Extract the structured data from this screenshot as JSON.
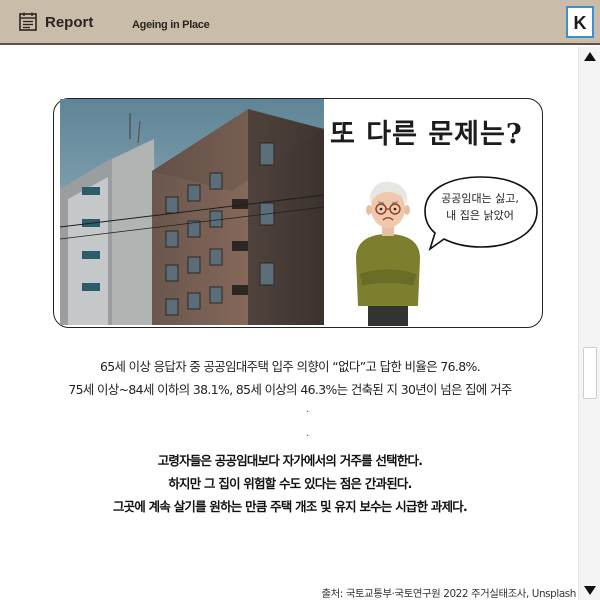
{
  "header": {
    "title": "Report",
    "subtitle": "Ageing in Place",
    "logo_letter": "K",
    "accent": "#c9bca8"
  },
  "card": {
    "headline": "또 다른 문제는?",
    "speech_line_1": "공공임대는 싫고,",
    "speech_line_2": "내 집은 낡았어"
  },
  "stats": {
    "line_1": "65세 이상 응답자 중 공공임대주택 입주 의향이 “없다”고 답한 비율은 76.8%.",
    "line_2": "75세 이상~84세 이하의 38.1%, 85세 이상의 46.3%는 건축된 지 30년이 넘은 집에 거주",
    "dot_1": ".",
    "dot_2": "."
  },
  "conclusion": {
    "line_1": "고령자들은 공공임대보다 자가에서의 거주를 선택한다.",
    "line_2": "하지만 그 집이 위험할 수도 있다는 점은 간과된다.",
    "line_3": "그곳에 계속 살기를 원하는 만큼 주택 개조 및 유지 보수는 시급한 과제다."
  },
  "footer": {
    "source": "출처: 국토교통부·국토연구원 2022 주거실태조사, Unsplash"
  },
  "icons": {
    "report": "document-icon",
    "logo": "k-logo-icon",
    "scroll_up": "arrow-up-icon",
    "scroll_down": "arrow-down-icon"
  }
}
